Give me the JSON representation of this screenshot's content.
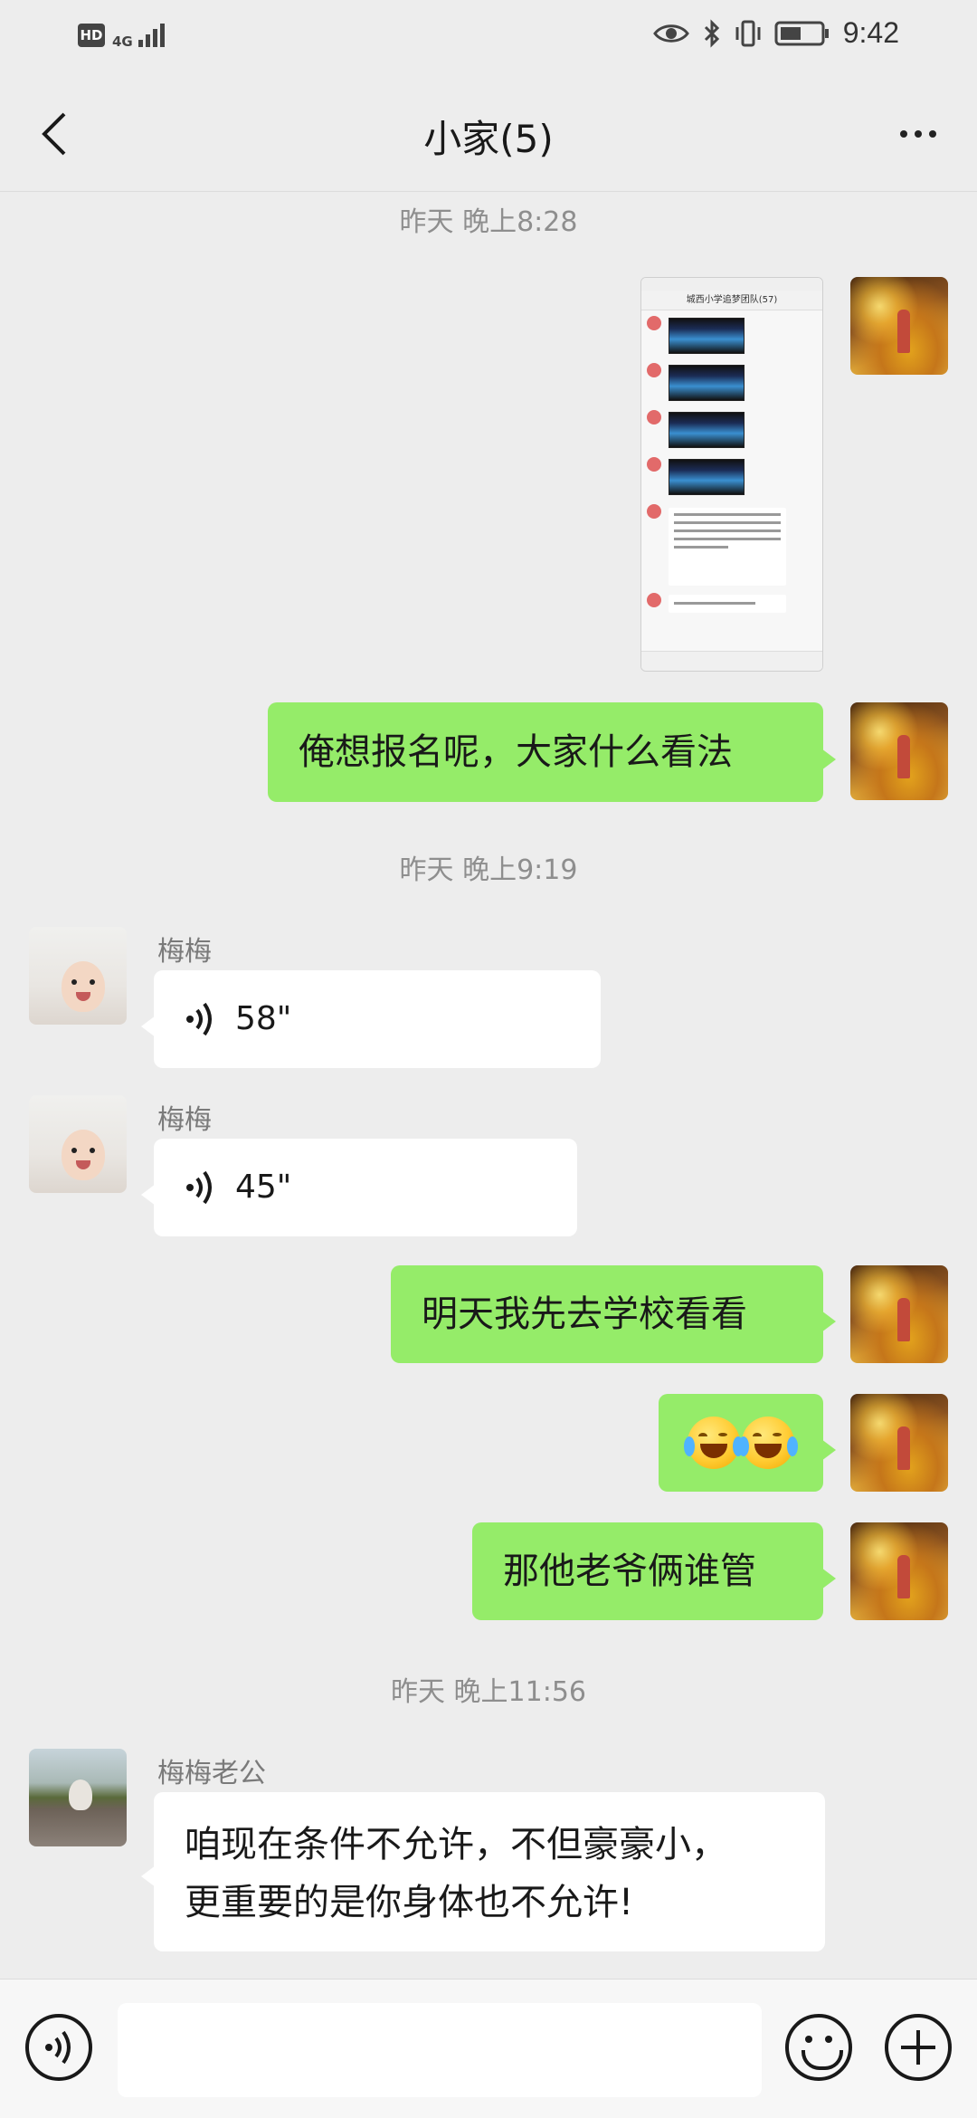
{
  "status_bar": {
    "hd_label": "HD",
    "network_label": "4G",
    "time": "9:42"
  },
  "header": {
    "title": "小家(5)",
    "back_icon": "chevron-left-icon",
    "more_icon": "more-dots-icon"
  },
  "messages": {
    "ts1": "昨天 晚上8:28",
    "ts2": "昨天 晚上9:19",
    "ts3": "昨天 晚上11:56",
    "screenshot_title": "城西小学追梦团队(57)",
    "m_signup": "俺想报名呢，大家什么看法",
    "sender_meimei": "梅梅",
    "voice1_len": "58\"",
    "voice2_len": "45\"",
    "m_school": "明天我先去学校看看",
    "m_who": "那他老爷俩谁管",
    "sender_husband": "梅梅老公",
    "m_husband_line1": "咱现在条件不允许，不但豪豪小，",
    "m_husband_line2": "更重要的是你身体也不允许!"
  },
  "input_bar": {
    "placeholder": "",
    "voice_icon": "voice-mode-icon",
    "emoji_icon": "emoji-icon",
    "plus_icon": "plus-icon"
  },
  "colors": {
    "bubble_self": "#95ec69",
    "bubble_other": "#ffffff",
    "background": "#ededed"
  }
}
